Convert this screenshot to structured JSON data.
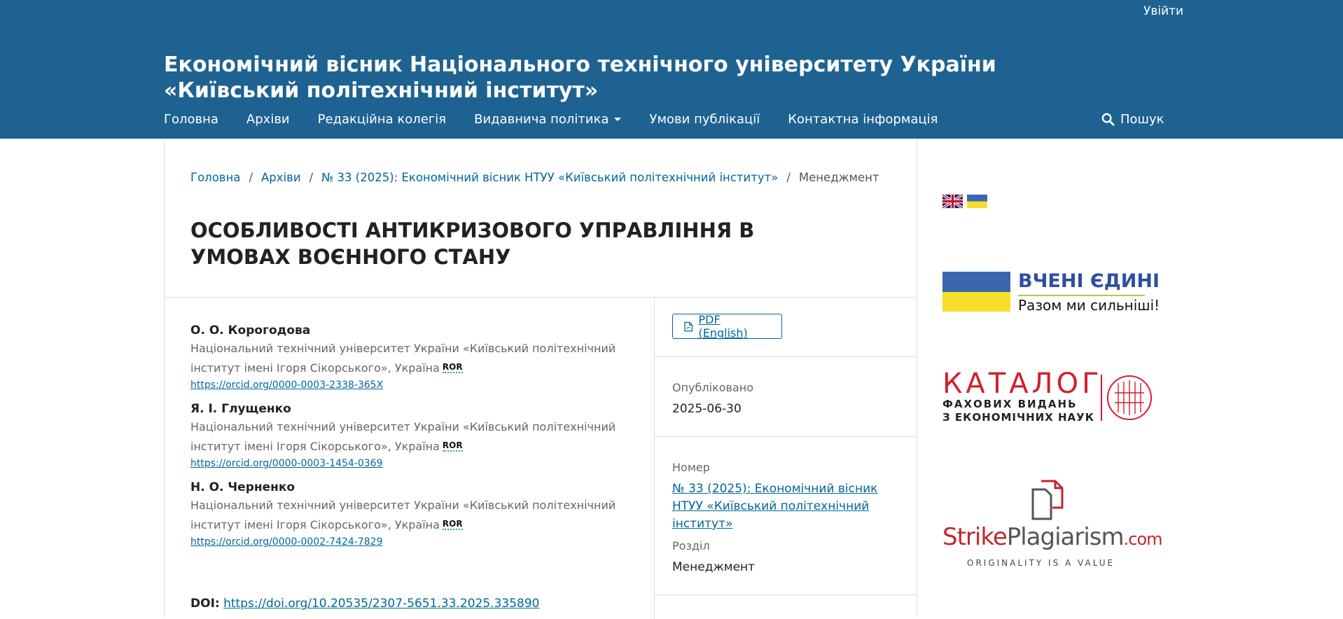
{
  "header": {
    "login": "Увійти",
    "site_title": "Економічний вісник Національного технічного університету України «Київський політехнічний інститут»",
    "nav": [
      "Головна",
      "Архіви",
      "Редакційна колегія",
      "Видавнича політика",
      "Умови публікації",
      "Контактна інформація"
    ],
    "search": "Пошук"
  },
  "breadcrumb": {
    "home": "Головна",
    "archives": "Архіви",
    "issue": "№ 33 (2025): Економічний вісник НТУУ «Київський політехнічний інститут»",
    "current": "Менеджмент"
  },
  "article": {
    "title": "ОСОБЛИВОСТІ АНТИКРИЗОВОГО УПРАВЛІННЯ В УМОВАХ ВОЄННОГО СТАНУ",
    "authors": [
      {
        "name": "О. О. Корогодова",
        "affiliation": "Національний технічний університет України «Київський політехнічний інститут імені Ігоря Сікорського», Україна",
        "orcid": "https://orcid.org/0000-0003-2338-365X"
      },
      {
        "name": "Я. І. Глущенко",
        "affiliation": "Національний технічний університет України «Київський політехнічний інститут імені Ігоря Сікорського», Україна",
        "orcid": "https://orcid.org/0000-0003-1454-0369"
      },
      {
        "name": "Н. О. Черненко",
        "affiliation": "Національний технічний університет України «Київський політехнічний інститут імені Ігоря Сікорського», Україна",
        "orcid": "https://orcid.org/0000-0002-7424-7829"
      }
    ],
    "ror_label": "ROR",
    "doi_label": "DOI:",
    "doi": "https://doi.org/10.20535/2307-5651.33.2025.335890"
  },
  "side": {
    "pdf_button": "PDF (English)",
    "published_label": "Опубліковано",
    "published_date": "2025-06-30",
    "issue_label": "Номер",
    "issue_link": "№ 33 (2025): Економічний вісник НТУУ «Київський політехнічний інститут»",
    "section_label": "Розділ",
    "section_value": "Менеджмент"
  },
  "sidebar": {
    "united_line1": "ВЧЕНІ ЄДИНІ",
    "united_line2": "Разом ми сильніші!",
    "catalog_line1": "КАТАЛОГ",
    "catalog_line2": "ФАХОВИХ ВИДАНЬ",
    "catalog_line3": "З ЕКОНОМІЧНИХ НАУК",
    "strike_part1": "Strike",
    "strike_part2": "Plagiarism",
    "strike_part3": ".com",
    "strike_tagline": "ORIGINALITY IS A VALUE"
  },
  "colors": {
    "header_bg": "#1e6292",
    "link": "#006798",
    "flag_blue": "#3a66b0",
    "flag_yellow": "#f6dd2b",
    "catalog_red": "#d21f2e",
    "strike_red": "#c1272d"
  }
}
